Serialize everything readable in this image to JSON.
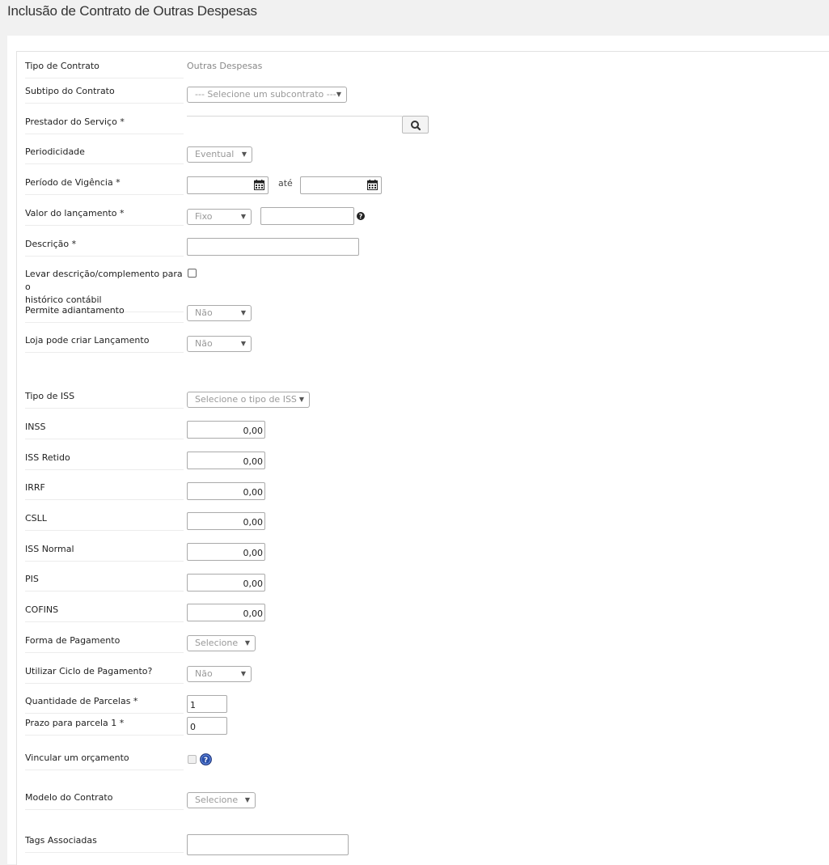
{
  "page_title": "Inclusão de Contrato de Outras Despesas",
  "fields": {
    "tipo_contrato": {
      "label": "Tipo de Contrato",
      "value": "Outras Despesas"
    },
    "subtipo": {
      "label": "Subtipo do Contrato",
      "selected": "--- Selecione um subcontrato ---"
    },
    "prestador": {
      "label": "Prestador do Serviço *",
      "value": ""
    },
    "periodicidade": {
      "label": "Periodicidade",
      "selected": "Eventual"
    },
    "vigencia": {
      "label": "Período de Vigência *",
      "separator": "até",
      "start": "",
      "end": ""
    },
    "valor": {
      "label": "Valor do lançamento *",
      "selected": "Fixo",
      "value": ""
    },
    "descricao": {
      "label": "Descrição *",
      "value": ""
    },
    "levar_descricao": {
      "label_line1": "Levar descrição/complemento para o",
      "label_line2": "histórico contábil",
      "checked": false
    },
    "permite_adiantamento": {
      "label": "Permite adiantamento",
      "selected": "Não"
    },
    "loja_pode_criar": {
      "label": "Loja pode criar Lançamento",
      "selected": "Não"
    },
    "tipo_iss": {
      "label": "Tipo de ISS",
      "selected": "Selecione o tipo de ISS"
    },
    "inss": {
      "label": "INSS",
      "value": "0,00"
    },
    "iss_retido": {
      "label": "ISS Retido",
      "value": "0,00"
    },
    "irrf": {
      "label": "IRRF",
      "value": "0,00"
    },
    "csll": {
      "label": "CSLL",
      "value": "0,00"
    },
    "iss_normal": {
      "label": "ISS Normal",
      "value": "0,00"
    },
    "pis": {
      "label": "PIS",
      "value": "0,00"
    },
    "cofins": {
      "label": "COFINS",
      "value": "0,00"
    },
    "forma_pagamento": {
      "label": "Forma de Pagamento",
      "selected": "Selecione"
    },
    "ciclo_pagamento": {
      "label": "Utilizar Ciclo de Pagamento?",
      "selected": "Não"
    },
    "quantidade_parcelas": {
      "label": "Quantidade de Parcelas *",
      "value": "1"
    },
    "prazo_parcela": {
      "label": "Prazo para parcela 1 *",
      "value": "0"
    },
    "vincular_orcamento": {
      "label": "Vincular um orçamento",
      "checked": false
    },
    "modelo_contrato": {
      "label": "Modelo do Contrato",
      "selected": "Selecione"
    },
    "tags": {
      "label": "Tags Associadas",
      "value": ""
    }
  },
  "icons": {
    "search": "search-icon",
    "calendar": "calendar-icon",
    "help": "question-circle-icon",
    "help_badge": "help-badge-icon"
  },
  "colors": {
    "help_badge": "#2a4fa8",
    "border": "#aaaaaa"
  }
}
